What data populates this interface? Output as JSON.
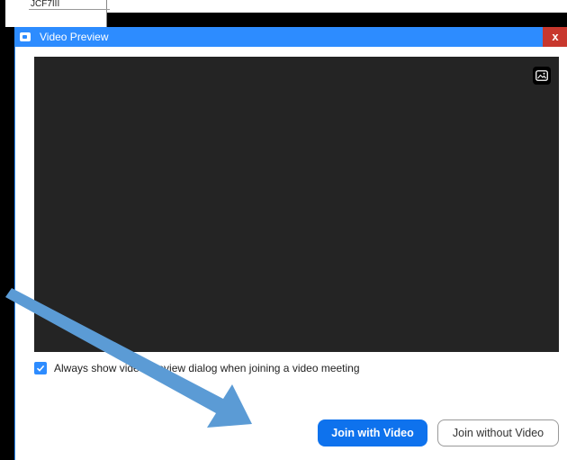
{
  "background_app": {
    "panel_text": "JCF7III"
  },
  "dialog": {
    "title": "Video Preview",
    "close_label": "x",
    "checkbox_label": "Always show video preview dialog when joining a video meeting",
    "checkbox_checked": true,
    "join_with_video_label": "Join with Video",
    "join_without_video_label": "Join without Video"
  },
  "icons": {
    "title": "zoom-camera-icon",
    "background": "virtual-background-icon",
    "check": "checkmark-icon"
  },
  "colors": {
    "accent": "#2d8cff",
    "primary_button": "#0e72ed",
    "close": "#c8372d",
    "video_bg": "#242424",
    "annotation_arrow": "#5b9bd5"
  }
}
